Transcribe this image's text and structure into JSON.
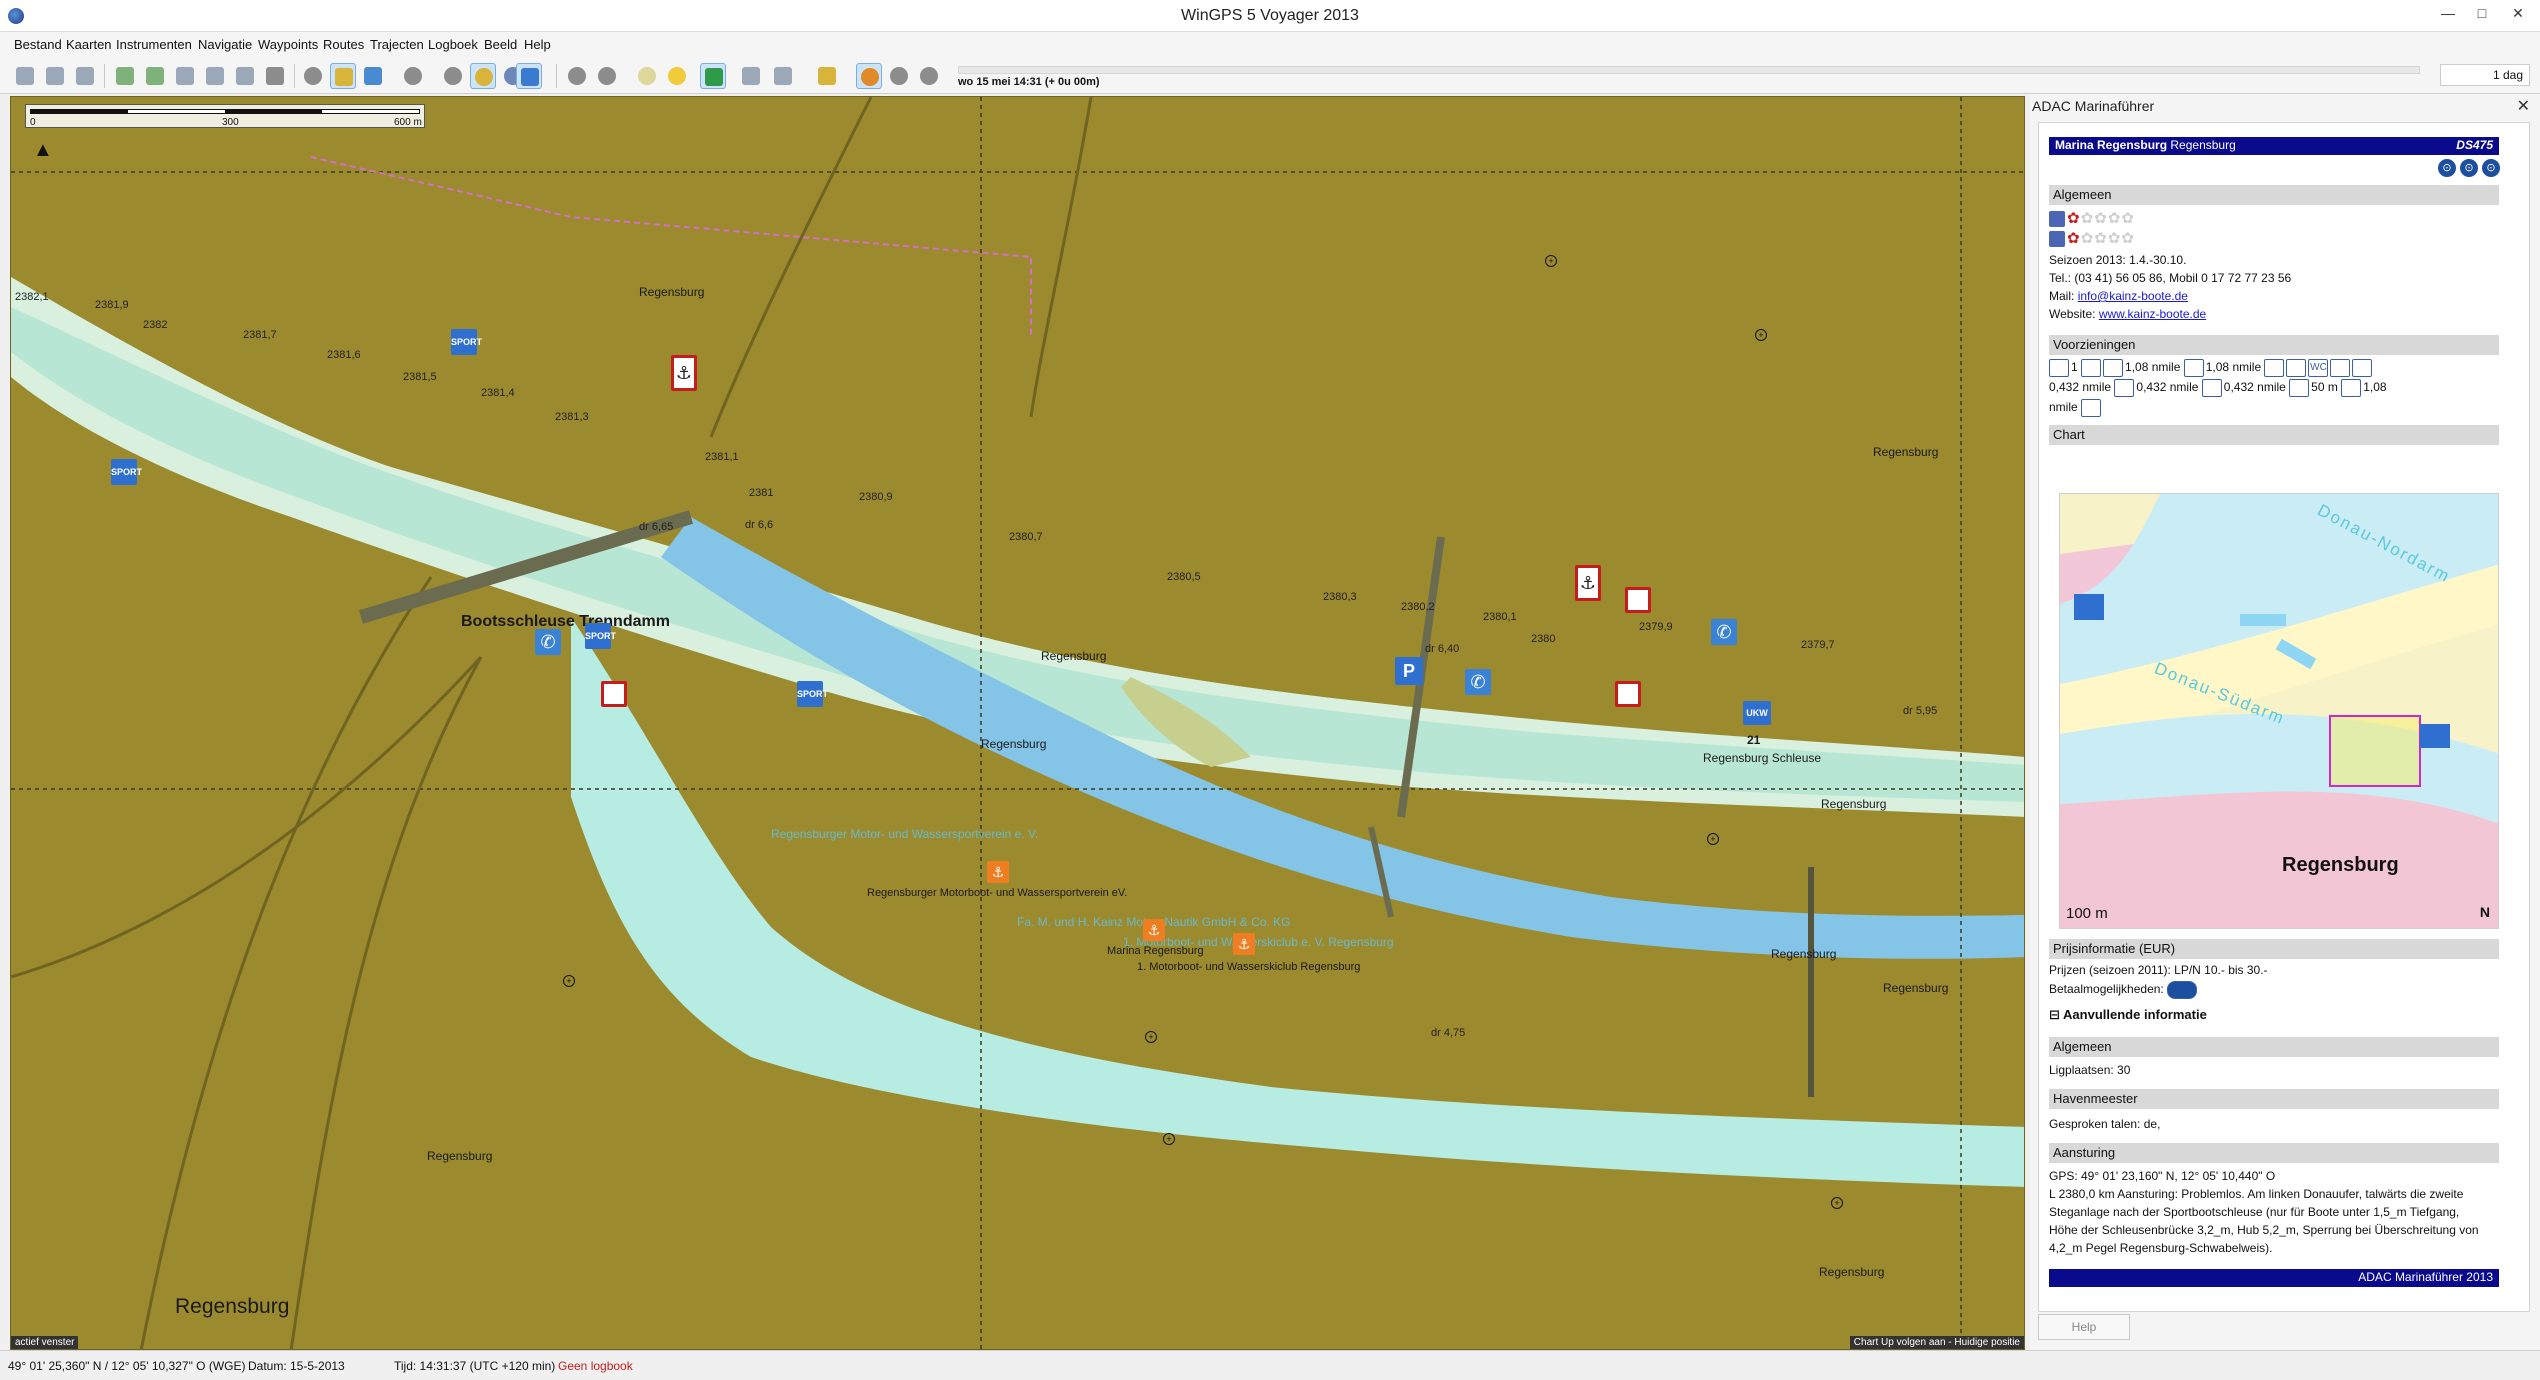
{
  "window": {
    "title": "WinGPS 5 Voyager 2013",
    "min_label": "—",
    "max_label": "□",
    "close_label": "✕"
  },
  "menu": [
    "Bestand",
    "Kaarten",
    "Instrumenten",
    "Navigatie",
    "Waypoints",
    "Routes",
    "Trajecten",
    "Logboek",
    "Beeld",
    "Help"
  ],
  "toolbar": {
    "status_time": "wo 15 mei 14:31  (+ 0u 00m)",
    "range": "1 dag"
  },
  "map": {
    "scale_ticks": [
      "0",
      "300",
      "600 m"
    ],
    "north_symbol": "▲",
    "active_window": "actief venster",
    "chart_mode": "Chart Up volgen aan - Huidige positie",
    "labels": {
      "regensburg_1": "Regensburg",
      "regensburg_2": "Regensburg",
      "regensburg_3": "Regensburg",
      "regensburg_4": "Regensburg",
      "regensburg_5": "Regensburg",
      "regensburg_6": "Regensburg",
      "regensburg_7": "Regensburg",
      "regensburg_8": "Regensburg",
      "regensburg_9": "Regensburg",
      "regensburg_big": "Regensburg",
      "schleuse": "Bootsschleuse Trenndamm",
      "regensburg_schleuse": "Regensburg Schleuse",
      "num_21": "21",
      "club_ghost": "Regensburger Motor- und Wassersportverein e. V.",
      "club_label": "Regensburger Motorboot- und Wassersportverein eV.",
      "kainz_ghost": "Fa. M. und H. Kainz Motor- Nautik GmbH & Co. KG",
      "marina_label": "Marina Regensburg",
      "wasserski_label": "1. Motorboot- und Wasserskiclub Regensburg",
      "wasserski_ghost": "1. Motorboot- und Wasserskiclub e. V. Regensburg",
      "dr665": "dr 6,65",
      "dr66": "dr 6,6",
      "dr640": "dr 6,40",
      "dr595": "dr 5,95",
      "dr475": "dr 4,75",
      "km2382_1": "2382,1",
      "km2381_9": "2381,9",
      "km2382": "2382",
      "km2381_7": "2381,7",
      "km2381_6": "2381,6",
      "km2381_5": "2381,5",
      "km2381_4": "2381,4",
      "km2381_3": "2381,3",
      "km2381_1": "2381,1",
      "km2381": "2381",
      "km2380_9": "2380,9",
      "km2380_7": "2380,7",
      "km2380_5": "2380,5",
      "km2380_3": "2380,3",
      "km2380_2": "2380,2",
      "km2380_1": "2380,1",
      "km2380": "2380",
      "km2379_9": "2379,9",
      "km2379_7": "2379,7"
    },
    "symbols": {
      "sport": "SPORT",
      "phone": "✆",
      "parking": "P",
      "anchor": "⚓",
      "ukw": "UKW",
      "orange": "⚓",
      "cross": "+"
    }
  },
  "panel": {
    "title": "ADAC Marinaführer",
    "close": "✕",
    "marina_name": "Marina Regensburg",
    "marina_city": "Regensburg",
    "code": "DS475",
    "header_icons": [
      "⊙",
      "⊙",
      "⊙"
    ],
    "algemeen": {
      "title": "Algemeen",
      "stars_on": "✿",
      "stars_off": "✿✿✿✿",
      "season": "Seizoen 2013: 1.4.-30.10.",
      "tel": "Tel.: (03 41) 56 05 86, Mobil 0 17 72 77 23 56",
      "mail_label": "Mail:",
      "mail": "info@kainz-boote.de",
      "website_label": "Website:",
      "website": "www.kainz-boote.de"
    },
    "voorzieningen": {
      "title": "Voorzieningen",
      "line1": [
        "1",
        "1,08 nmile",
        "1,08 nmile",
        "WC"
      ],
      "line2": [
        "0,432 nmile",
        "0,432 nmile",
        "0,432 nmile",
        "50 m",
        "1,08"
      ],
      "line3": "nmile"
    },
    "chart": {
      "title": "Chart",
      "label_nordarm": "Donau-Nordarm",
      "label_sudarm": "Donau-Südarm",
      "city": "Regensburg",
      "scale": "100 m",
      "north": "N"
    },
    "prijs": {
      "title": "Prijsinformatie (EUR)",
      "prices": "Prijzen (seizoen 2011): LP/N 10.- bis 30.-",
      "payment": "Betaalmogelijkheden:"
    },
    "aanvullend": {
      "title": "Aanvullende informatie",
      "toggle": "⊟"
    },
    "algemeen2": {
      "title": "Algemeen",
      "berths": "Ligplaatsen: 30"
    },
    "havenmeester": {
      "title": "Havenmeester",
      "languages": "Gesproken talen: de,"
    },
    "aansturing": {
      "title": "Aansturing",
      "gps": "GPS: 49° 01' 23,160\" N, 12° 05' 10,440\" O",
      "line1": "L 2380,0 km Aansturing: Problemlos. Am linken Donauufer, talwärts die zweite",
      "line2": "Steganlage nach der Sportbootschleuse (nur für Boote unter 1,5_m Tiefgang,",
      "line3": "Höhe der Schleusenbrücke 3,2_m, Hub 5,2_m, Sperrung bei Überschreitung von",
      "line4": "4,2_m Pegel Regensburg-Schwabelweis)."
    },
    "footer": "ADAC Marinaführer 2013",
    "help": "Help"
  },
  "statusbar": {
    "position": "49° 01' 25,360\" N / 12° 05' 10,327\" O (WGE)",
    "date": "Datum: 15-5-2013",
    "time": "Tijd: 14:31:37 (UTC +120 min)",
    "logbook": "Geen logbook"
  }
}
